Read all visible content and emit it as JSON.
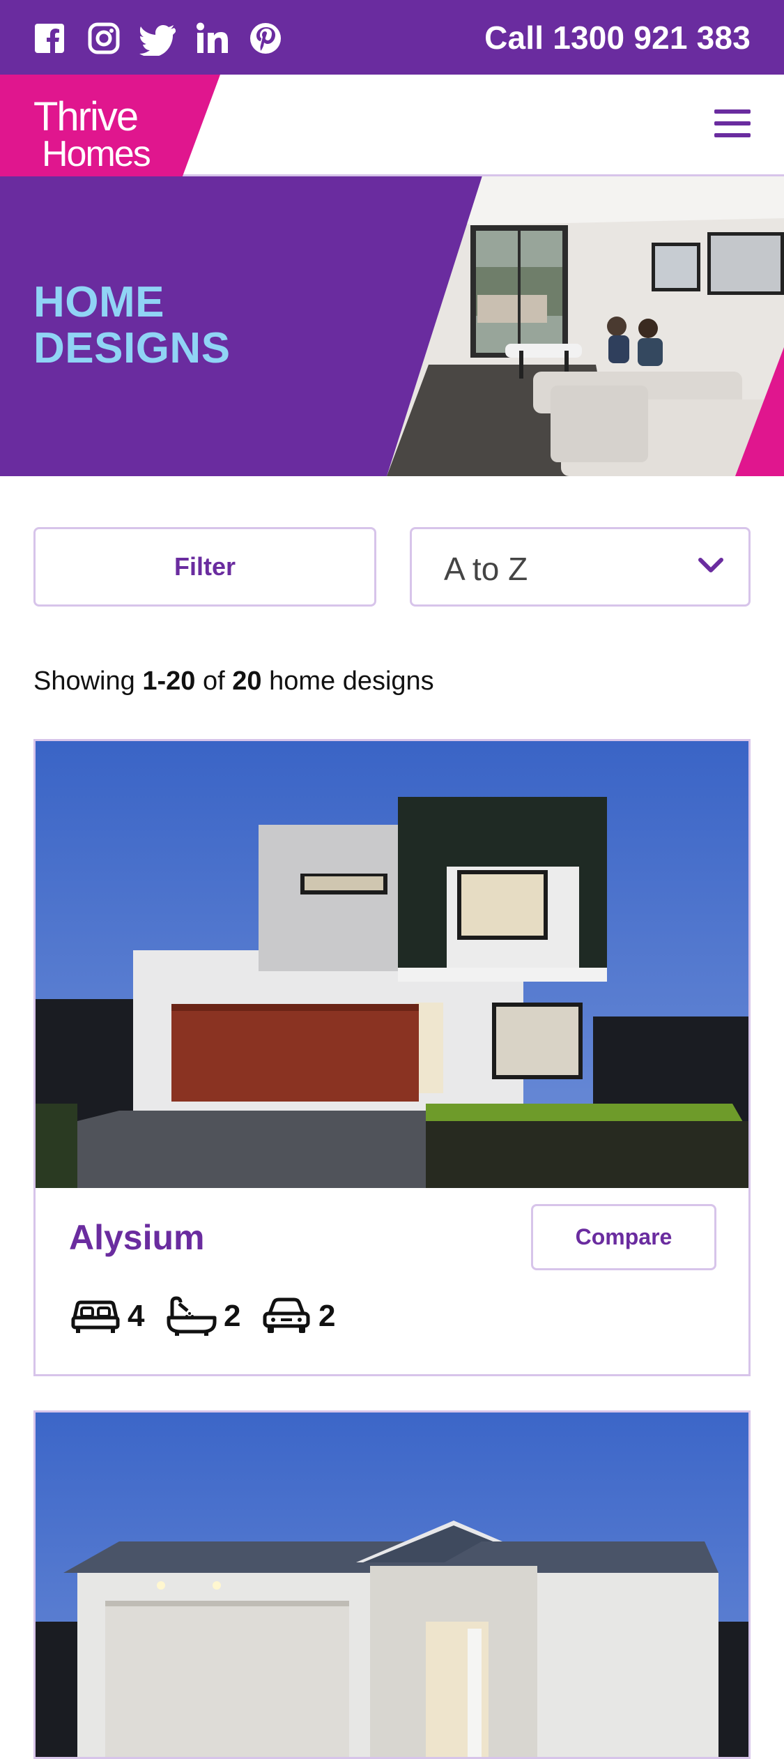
{
  "topbar": {
    "social": [
      "facebook-icon",
      "instagram-icon",
      "twitter-icon",
      "linkedin-icon",
      "pinterest-icon"
    ],
    "call_text": "Call 1300 921 383"
  },
  "brand": {
    "line1": "Thrive",
    "line2": "Homes",
    "pink": "#e0168e",
    "purple": "#6a2c9f",
    "light_blue": "#90d4f5",
    "border": "#d7c4ea"
  },
  "hero": {
    "title_line1": "HOME",
    "title_line2": "DESIGNS"
  },
  "controls": {
    "filter_label": "Filter",
    "sort_value": "A to Z"
  },
  "results": {
    "prefix": "Showing",
    "from": "1",
    "to": "20",
    "of": "of",
    "total": "20",
    "suffix": "home designs"
  },
  "designs": [
    {
      "name": "Alysium",
      "compare_label": "Compare",
      "beds": "4",
      "baths": "2",
      "cars": "2"
    }
  ]
}
